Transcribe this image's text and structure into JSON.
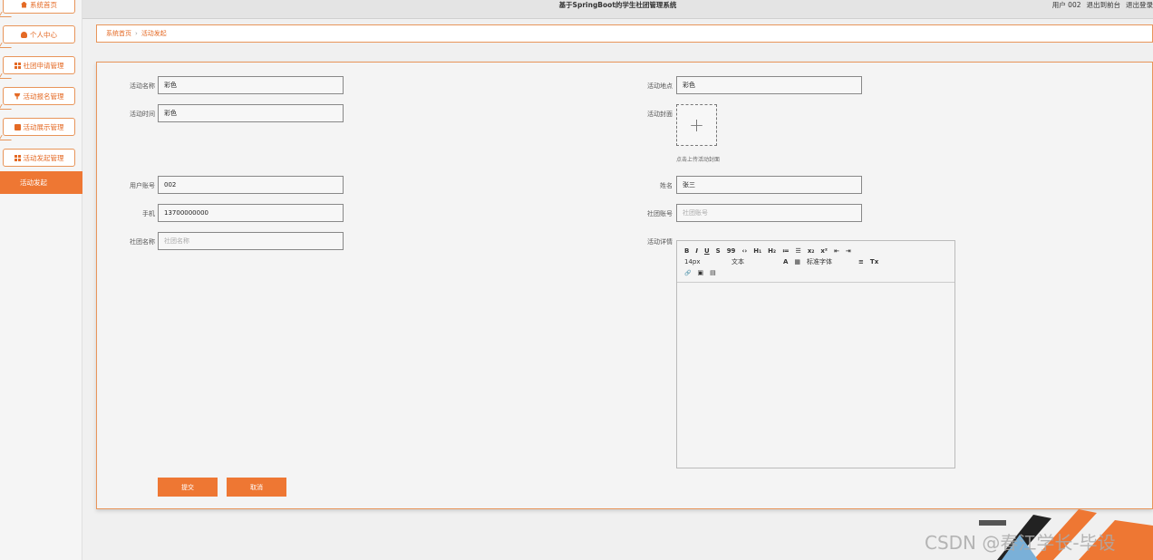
{
  "app": {
    "title": "基于SpringBoot的学生社团管理系统",
    "user": "用户 002",
    "back_to_front": "退出到前台",
    "logout": "退出登录"
  },
  "sidebar": {
    "items": [
      {
        "label": "系统首页",
        "icon": "home-icon"
      },
      {
        "label": "个人中心",
        "icon": "user-icon"
      },
      {
        "label": "社团申请管理",
        "icon": "grid-icon"
      },
      {
        "label": "活动报名管理",
        "icon": "cup-icon"
      },
      {
        "label": "活动展示管理",
        "icon": "calendar-icon"
      },
      {
        "label": "活动发起管理",
        "icon": "grid-icon"
      }
    ],
    "active": "活动发起"
  },
  "breadcrumb": {
    "home": "系统首页",
    "sep": "›",
    "current": "活动发起"
  },
  "form": {
    "activity_name_label": "活动名称",
    "activity_name_value": "彩色",
    "activity_place_label": "活动地点",
    "activity_place_value": "彩色",
    "activity_time_label": "活动时间",
    "activity_time_value": "彩色",
    "activity_cover_label": "活动封面",
    "upload_hint": "点击上传活动封面",
    "user_account_label": "用户账号",
    "user_account_value": "002",
    "name_label": "姓名",
    "name_value": "张三",
    "phone_label": "手机",
    "phone_value": "13700000000",
    "club_account_label": "社团账号",
    "club_account_placeholder": "社团账号",
    "club_name_label": "社团名称",
    "club_name_placeholder": "社团名称",
    "activity_detail_label": "活动详情"
  },
  "editor": {
    "row1": [
      "B",
      "I",
      "U",
      "S",
      "99",
      "‹›",
      "H₁",
      "H₂",
      "≔",
      "☰",
      "x₂",
      "x²",
      "⇤",
      "⇥"
    ],
    "font_size": "14px",
    "text_type": "文本",
    "font_family": "标准字体",
    "row2_extra": [
      "A",
      "▦",
      "≡",
      "Tx"
    ],
    "row3": [
      "🔗",
      "▣",
      "▤"
    ]
  },
  "buttons": {
    "submit": "提交",
    "cancel": "取消"
  },
  "watermark": {
    "text": "CSDN @春江学长-毕设"
  },
  "colors": {
    "accent": "#ee7733",
    "border": "#e8955a"
  }
}
